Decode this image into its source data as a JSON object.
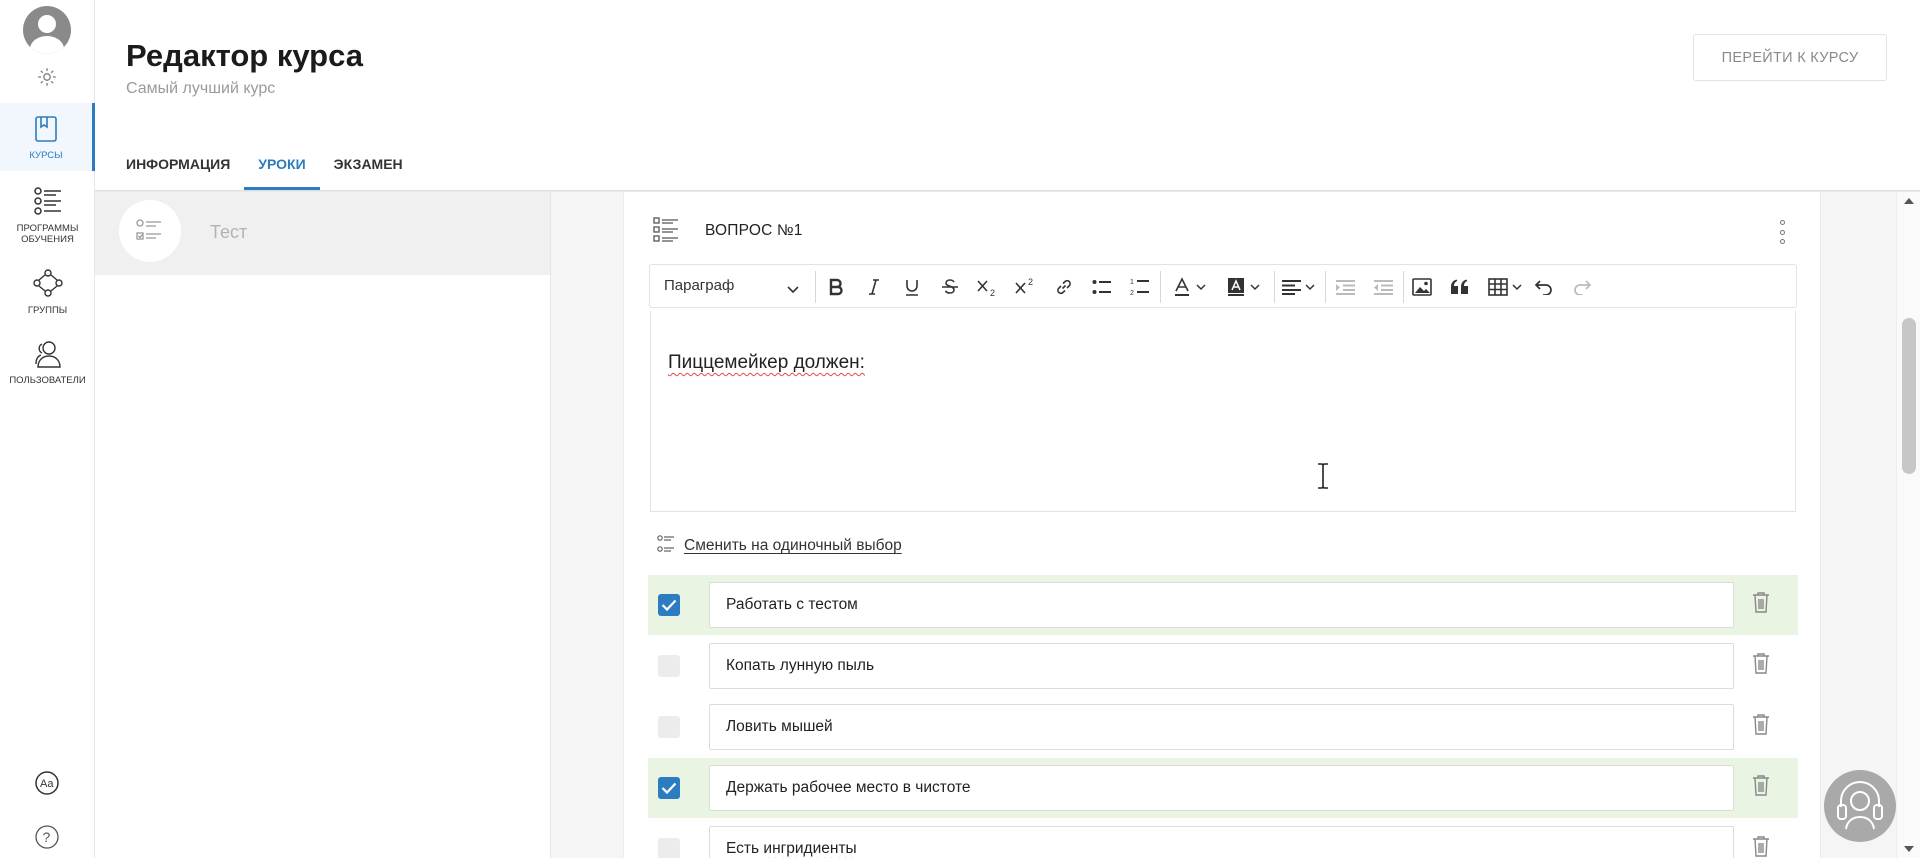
{
  "rail": {
    "items": [
      {
        "label": "КУРСЫ",
        "icon": "courses-icon"
      },
      {
        "label": "ПРОГРАММЫ ОБУЧЕНИЯ",
        "icon": "programs-icon"
      },
      {
        "label": "ГРУППЫ",
        "icon": "groups-icon"
      },
      {
        "label": "ПОЛЬЗОВАТЕЛИ",
        "icon": "users-icon"
      }
    ],
    "active_color": "#2b7cc0"
  },
  "header": {
    "title": "Редактор курса",
    "subtitle": "Самый лучший курс",
    "goto_button": "ПЕРЕЙТИ К КУРСУ"
  },
  "tabs": [
    {
      "label": "ИНФОРМАЦИЯ",
      "active": false
    },
    {
      "label": "УРОКИ",
      "active": true
    },
    {
      "label": "ЭКЗАМЕН",
      "active": false
    }
  ],
  "lessons": [
    {
      "name": "Тест",
      "icon": "test-icon"
    }
  ],
  "question": {
    "title": "ВОПРОС №1",
    "toolbar": {
      "paragraph_select": "Параграф",
      "buttons": [
        "bold-icon",
        "italic-icon",
        "underline-icon",
        "strikethrough-icon",
        "subscript-icon",
        "superscript-icon",
        "link-icon",
        "bulleted-list-icon",
        "numbered-list-icon",
        "font-color-icon",
        "background-color-icon",
        "align-icon",
        "outdent-icon",
        "indent-icon",
        "image-icon",
        "quote-icon",
        "table-icon",
        "undo-icon",
        "redo-icon"
      ]
    },
    "body_text": "Пиццемейкер должен:",
    "switch_label": "Сменить на одиночный выбор",
    "answers": [
      {
        "text": "Работать с тестом",
        "correct": true
      },
      {
        "text": "Копать лунную пыль",
        "correct": false
      },
      {
        "text": "Ловить мышей",
        "correct": false
      },
      {
        "text": "Держать рабочее место в чистоте",
        "correct": true
      },
      {
        "text_before": "Есть ",
        "text_misspelled": "ингридиенты",
        "correct": false
      }
    ]
  },
  "colors": {
    "accent": "#2b7cc0",
    "correct_row": "#eaf4e3"
  }
}
